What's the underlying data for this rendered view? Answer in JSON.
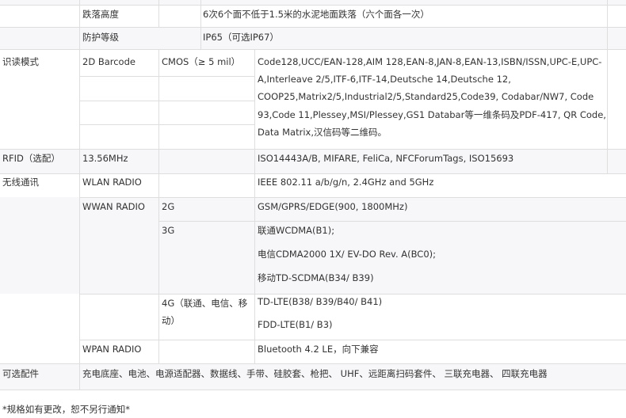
{
  "rows": {
    "drop": {
      "label": "跌落高度",
      "value": "6次6个面不低于1.5米的水泥地面跌落（六个面各一次）"
    },
    "protection": {
      "label": "防护等级",
      "value": "IP65（可选IP67）"
    },
    "scan": {
      "category": "识读模式",
      "type": "2D Barcode",
      "sensor": "CMOS（≥ 5 mil）",
      "symbologies": "Code128,UCC/EAN-128,AIM 128,EAN-8,JAN-8,EAN-13,ISBN/ISSN,UPC-E,UPC-A,Interleave 2/5,ITF-6,ITF-14,Deutsche 14,Deutsche 12, COOP25,Matrix2/5,Industrial2/5,Standard25,Code39, Codabar/NW7, Code 93,Code 11,Plessey,MSI/Plessey,GS1 Databar等一维条码及PDF-417, QR Code, Data Matrix,汉信码等二维码。"
    },
    "rfid": {
      "category": "RFID（选配）",
      "freq": "13.56MHz",
      "standards": "ISO14443A/B, MIFARE, FeliCa, NFCForumTags, ISO15693"
    },
    "wireless": {
      "category": "无线通讯",
      "wlan": {
        "label": "WLAN RADIO",
        "value": "IEEE 802.11 a/b/g/n, 2.4GHz and 5GHz"
      },
      "wwan": {
        "label": "WWAN RADIO",
        "g2": {
          "label": "2G",
          "value": "GSM/GPRS/EDGE(900, 1800MHz)"
        },
        "g3": {
          "label": "3G",
          "lines": [
            "联通WCDMA(B1);",
            "电信CDMA2000 1X/ EV-DO Rev. A(BC0);",
            "移动TD-SCDMA(B34/ B39)"
          ]
        },
        "g4": {
          "label": "4G（联通、电信、移动）",
          "lines": [
            "TD-LTE(B38/ B39/B40/ B41)",
            "FDD-LTE(B1/ B3)"
          ]
        }
      },
      "wpan": {
        "label": "WPAN RADIO",
        "value": "Bluetooth 4.2 LE，向下兼容"
      }
    },
    "accessories": {
      "label": "可选配件",
      "value": "充电底座、电池、电源适配器、数据线、手带、硅胶套、枪把、 UHF、远距离扫码套件、 三联充电器、 四联充电器"
    }
  },
  "footnote": "*规格如有更改，恕不另行通知*"
}
